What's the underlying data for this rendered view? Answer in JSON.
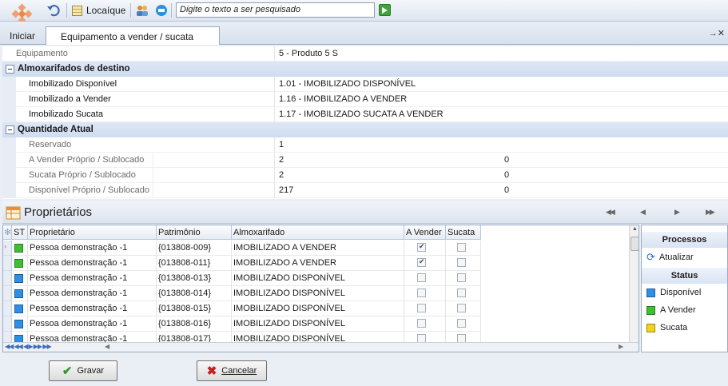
{
  "toolbar": {
    "locaique_label": "Locaíque",
    "search_placeholder": "Digite o texto a ser pesquisado"
  },
  "tabs": {
    "home": "Iniciar",
    "active": "Equipamento a vender / sucata"
  },
  "properties": {
    "equipamento_label": "Equipamento",
    "equipamento_value": "5 - Produto 5 S",
    "section1_title": "Almoxarifados de destino",
    "rows1": [
      {
        "label": "Imobilizado Disponível",
        "value": "1.01 - IMOBILIZADO DISPONÍVEL"
      },
      {
        "label": "Imobilizado a Vender",
        "value": "1.16 - IMOBILIZADO A VENDER"
      },
      {
        "label": "Imobilizado Sucata",
        "value": "1.17 - IMOBILIZADO SUCATA A VENDER"
      }
    ],
    "section2_title": "Quantidade Atual",
    "reservado_label": "Reservado",
    "reservado_value": "1",
    "rows2": [
      {
        "label": "A Vender Próprio / Sublocado",
        "v1": "2",
        "v2": "0"
      },
      {
        "label": "Sucata Próprio / Sublocado",
        "v1": "2",
        "v2": "0"
      },
      {
        "label": "Disponível Próprio / Sublocado",
        "v1": "217",
        "v2": "0"
      }
    ]
  },
  "owners": {
    "title": "Proprietários",
    "columns": [
      "ST",
      "Proprietário",
      "Patrimônio",
      "Almoxarifado",
      "A Vender",
      "Sucata"
    ],
    "rows": [
      {
        "status": "green",
        "owner": "Pessoa demonstração -1",
        "asset": "{013808-009}",
        "warehouse": "IMOBILIZADO A VENDER",
        "a_vender": true,
        "sucata": false
      },
      {
        "status": "green",
        "owner": "Pessoa demonstração -1",
        "asset": "{013808-011}",
        "warehouse": "IMOBILIZADO A VENDER",
        "a_vender": true,
        "sucata": false
      },
      {
        "status": "blue",
        "owner": "Pessoa demonstração -1",
        "asset": "{013808-013}",
        "warehouse": "IMOBILIZADO DISPONÍVEL",
        "a_vender": false,
        "sucata": false
      },
      {
        "status": "blue",
        "owner": "Pessoa demonstração -1",
        "asset": "{013808-014}",
        "warehouse": "IMOBILIZADO DISPONÍVEL",
        "a_vender": false,
        "sucata": false
      },
      {
        "status": "blue",
        "owner": "Pessoa demonstração -1",
        "asset": "{013808-015}",
        "warehouse": "IMOBILIZADO DISPONÍVEL",
        "a_vender": false,
        "sucata": false
      },
      {
        "status": "blue",
        "owner": "Pessoa demonstração -1",
        "asset": "{013808-016}",
        "warehouse": "IMOBILIZADO DISPONÍVEL",
        "a_vender": false,
        "sucata": false
      },
      {
        "status": "blue",
        "owner": "Pessoa demonstração -1",
        "asset": "{013808-017}",
        "warehouse": "IMOBILIZADO DISPONÍVEL",
        "a_vender": false,
        "sucata": false
      }
    ]
  },
  "side_panel": {
    "processos_title": "Processos",
    "atualizar": "Atualizar",
    "status_title": "Status",
    "status_items": [
      {
        "label": "Disponível",
        "color": "#2f8fe6"
      },
      {
        "label": "A Vender",
        "color": "#3fbf34"
      },
      {
        "label": "Sucata",
        "color": "#f2d21a"
      }
    ]
  },
  "status_colors": {
    "green": "#3fbf34",
    "blue": "#2f8fe6"
  },
  "buttons": {
    "gravar": "Gravar",
    "cancelar": "Cancelar"
  }
}
